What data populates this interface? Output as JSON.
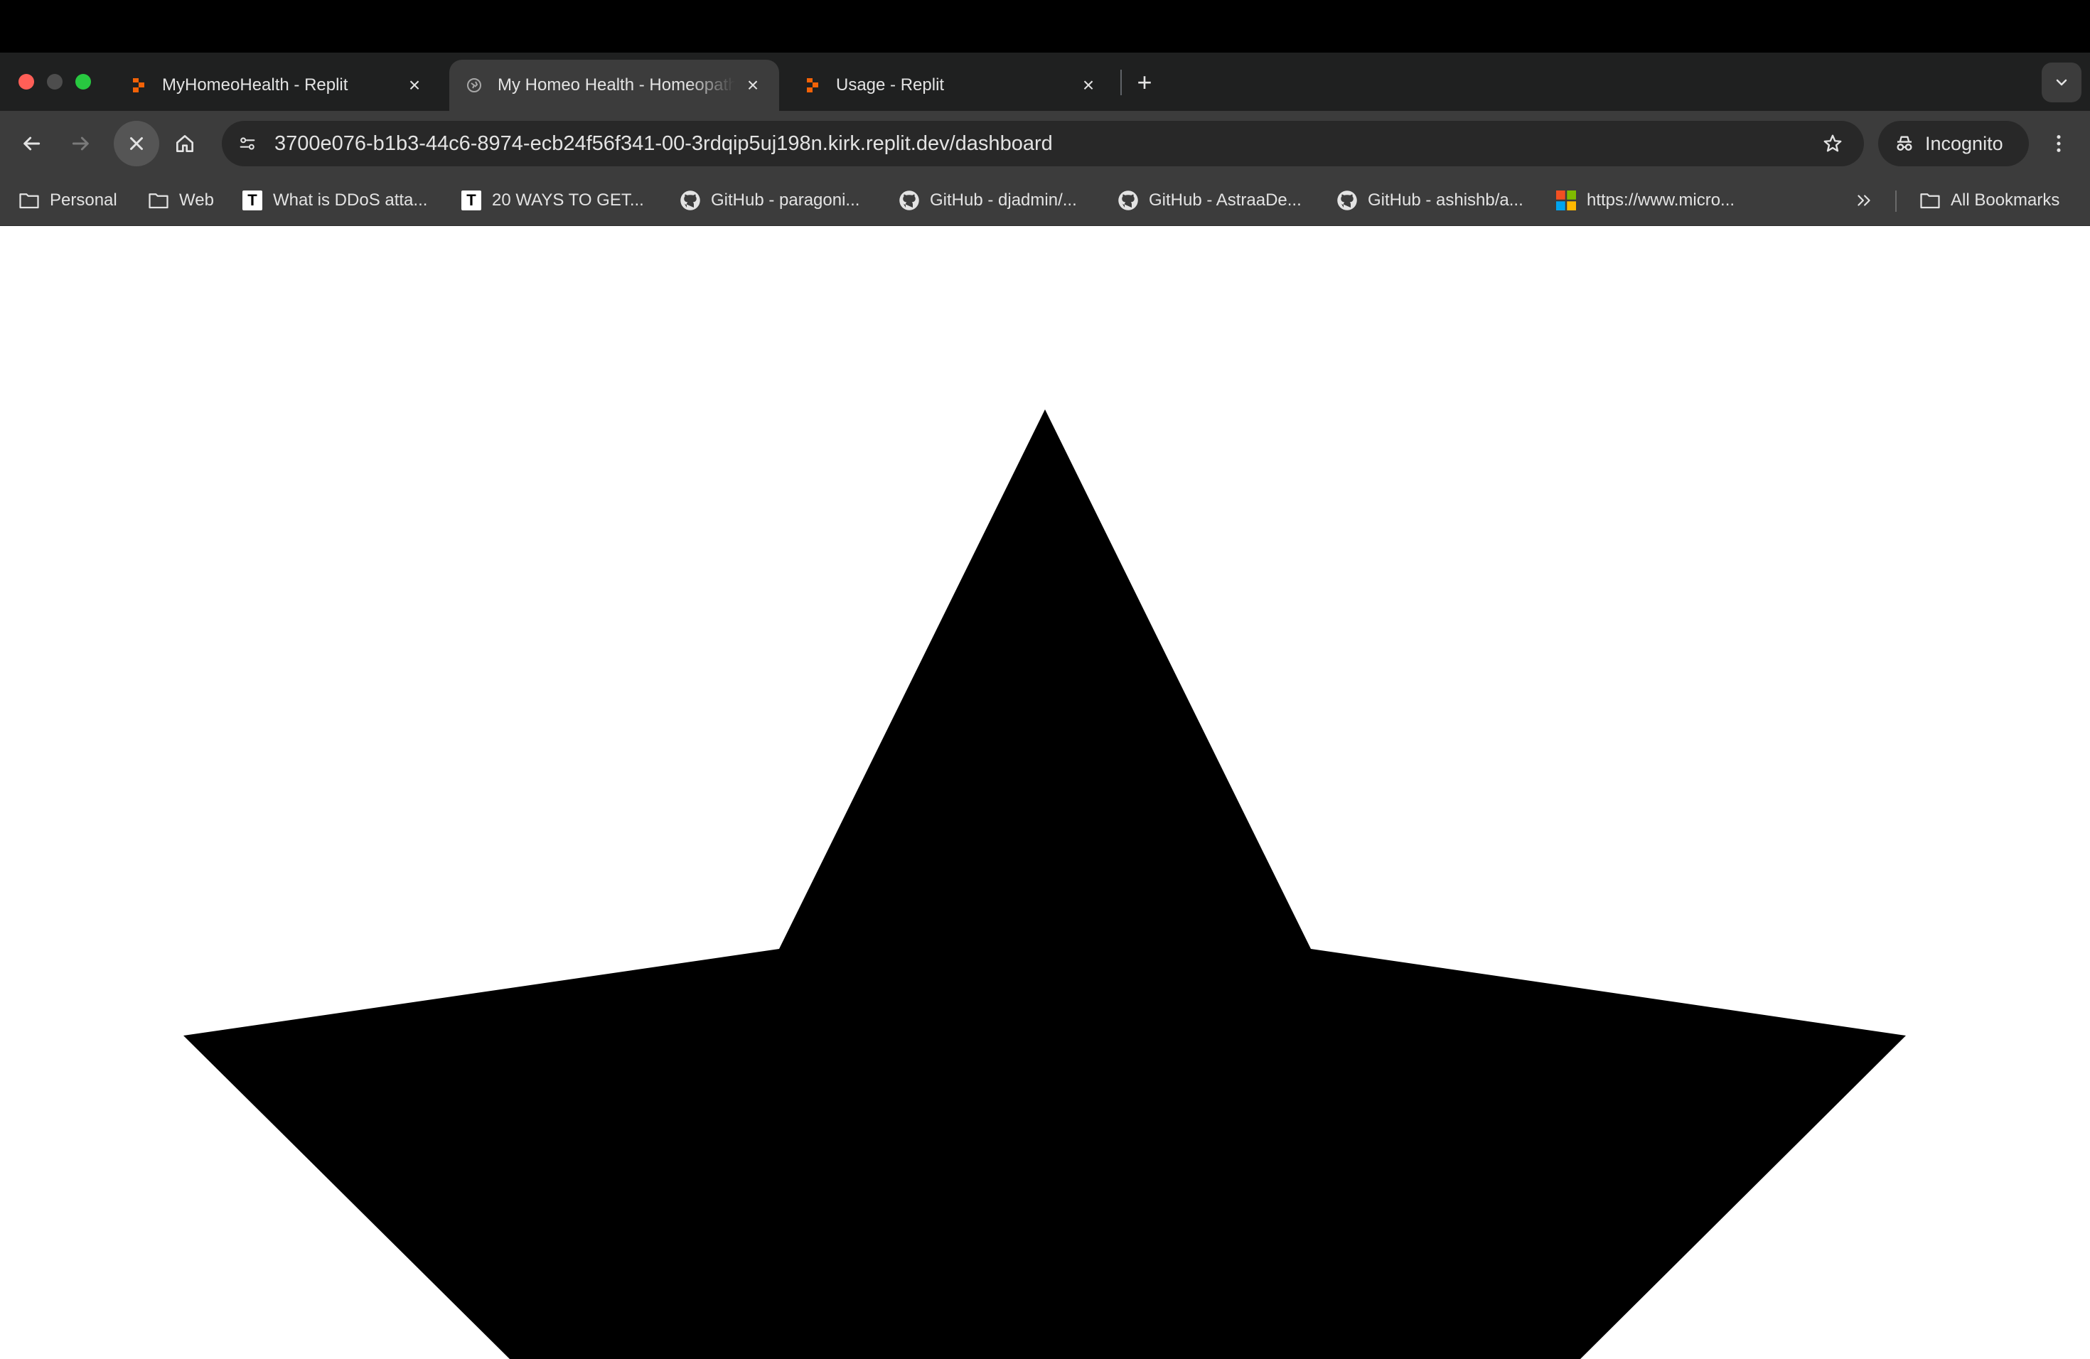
{
  "tabs": [
    {
      "title": "MyHomeoHealth - Replit",
      "favicon": "replit-icon"
    },
    {
      "title": "My Homeo Health - Homeopathy",
      "favicon": "globe-icon"
    },
    {
      "title": "Usage - Replit",
      "favicon": "replit-icon"
    }
  ],
  "toolbar": {
    "url": "3700e076-b1b3-44c6-8974-ecb24f56f341-00-3rdqip5uj198n.kirk.replit.dev/dashboard",
    "profile_label": "Incognito"
  },
  "bookmarks": [
    {
      "label": "Personal",
      "icon": "folder-icon"
    },
    {
      "label": "Web",
      "icon": "folder-icon"
    },
    {
      "label": "What is DDoS atta...",
      "icon": "t-icon"
    },
    {
      "label": "20 WAYS TO GET...",
      "icon": "t-icon"
    },
    {
      "label": "GitHub - paragoni...",
      "icon": "github-icon"
    },
    {
      "label": "GitHub - djadmin/...",
      "icon": "github-icon"
    },
    {
      "label": "GitHub - AstraaDe...",
      "icon": "github-icon"
    },
    {
      "label": "GitHub - ashishb/a...",
      "icon": "github-icon"
    },
    {
      "label": "https://www.micro...",
      "icon": "microsoft-icon"
    }
  ],
  "all_bookmarks_label": "All Bookmarks",
  "colors": {
    "star": "#000000",
    "tabstrip": "#1f2020",
    "toolbar": "#3c3c3c",
    "replit_orange": "#f26207"
  }
}
